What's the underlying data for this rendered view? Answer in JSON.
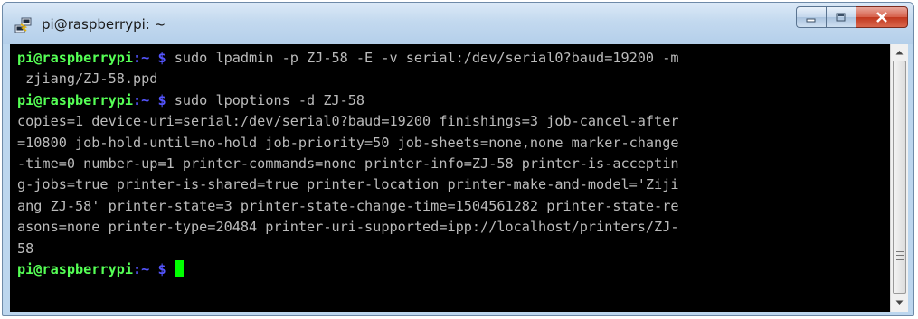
{
  "window": {
    "title": "pi@raspberrypi: ~"
  },
  "terminal": {
    "lines": [
      [
        {
          "t": "pi@raspberrypi",
          "c": "prompt-user"
        },
        {
          "t": ":~ $ ",
          "c": "prompt-path"
        },
        {
          "t": "sudo lpadmin -p ZJ-58 -E -v serial:/dev/serial0?baud=19200 -m",
          "c": "cmd"
        }
      ],
      [
        {
          "t": " zjiang/ZJ-58.ppd",
          "c": "cmd"
        }
      ],
      [
        {
          "t": "pi@raspberrypi",
          "c": "prompt-user"
        },
        {
          "t": ":~ $ ",
          "c": "prompt-path"
        },
        {
          "t": "sudo lpoptions -d ZJ-58",
          "c": "cmd"
        }
      ],
      [
        {
          "t": "copies=1 device-uri=serial:/dev/serial0?baud=19200 finishings=3 job-cancel-after",
          "c": "cmd"
        }
      ],
      [
        {
          "t": "=10800 job-hold-until=no-hold job-priority=50 job-sheets=none,none marker-change",
          "c": "cmd"
        }
      ],
      [
        {
          "t": "-time=0 number-up=1 printer-commands=none printer-info=ZJ-58 printer-is-acceptin",
          "c": "cmd"
        }
      ],
      [
        {
          "t": "g-jobs=true printer-is-shared=true printer-location printer-make-and-model='Ziji",
          "c": "cmd"
        }
      ],
      [
        {
          "t": "ang ZJ-58' printer-state=3 printer-state-change-time=1504561282 printer-state-re",
          "c": "cmd"
        }
      ],
      [
        {
          "t": "asons=none printer-type=20484 printer-uri-supported=ipp://localhost/printers/ZJ-",
          "c": "cmd"
        }
      ],
      [
        {
          "t": "58",
          "c": "cmd"
        }
      ],
      [
        {
          "t": "pi@raspberrypi",
          "c": "prompt-user"
        },
        {
          "t": ":~ $ ",
          "c": "prompt-path"
        },
        {
          "cursor": true
        }
      ]
    ]
  },
  "icons": {
    "app": "putty-icon",
    "minimize": "minimize-icon",
    "maximize": "maximize-icon",
    "close": "close-icon",
    "scroll_up": "scroll-up-arrow-icon",
    "scroll_down": "scroll-down-arrow-icon"
  },
  "colors": {
    "terminal_bg": "#000000",
    "prompt_user": "#55ff55",
    "prompt_path": "#5555ff",
    "output_text": "#bbbbbb",
    "cursor": "#00ff00"
  }
}
